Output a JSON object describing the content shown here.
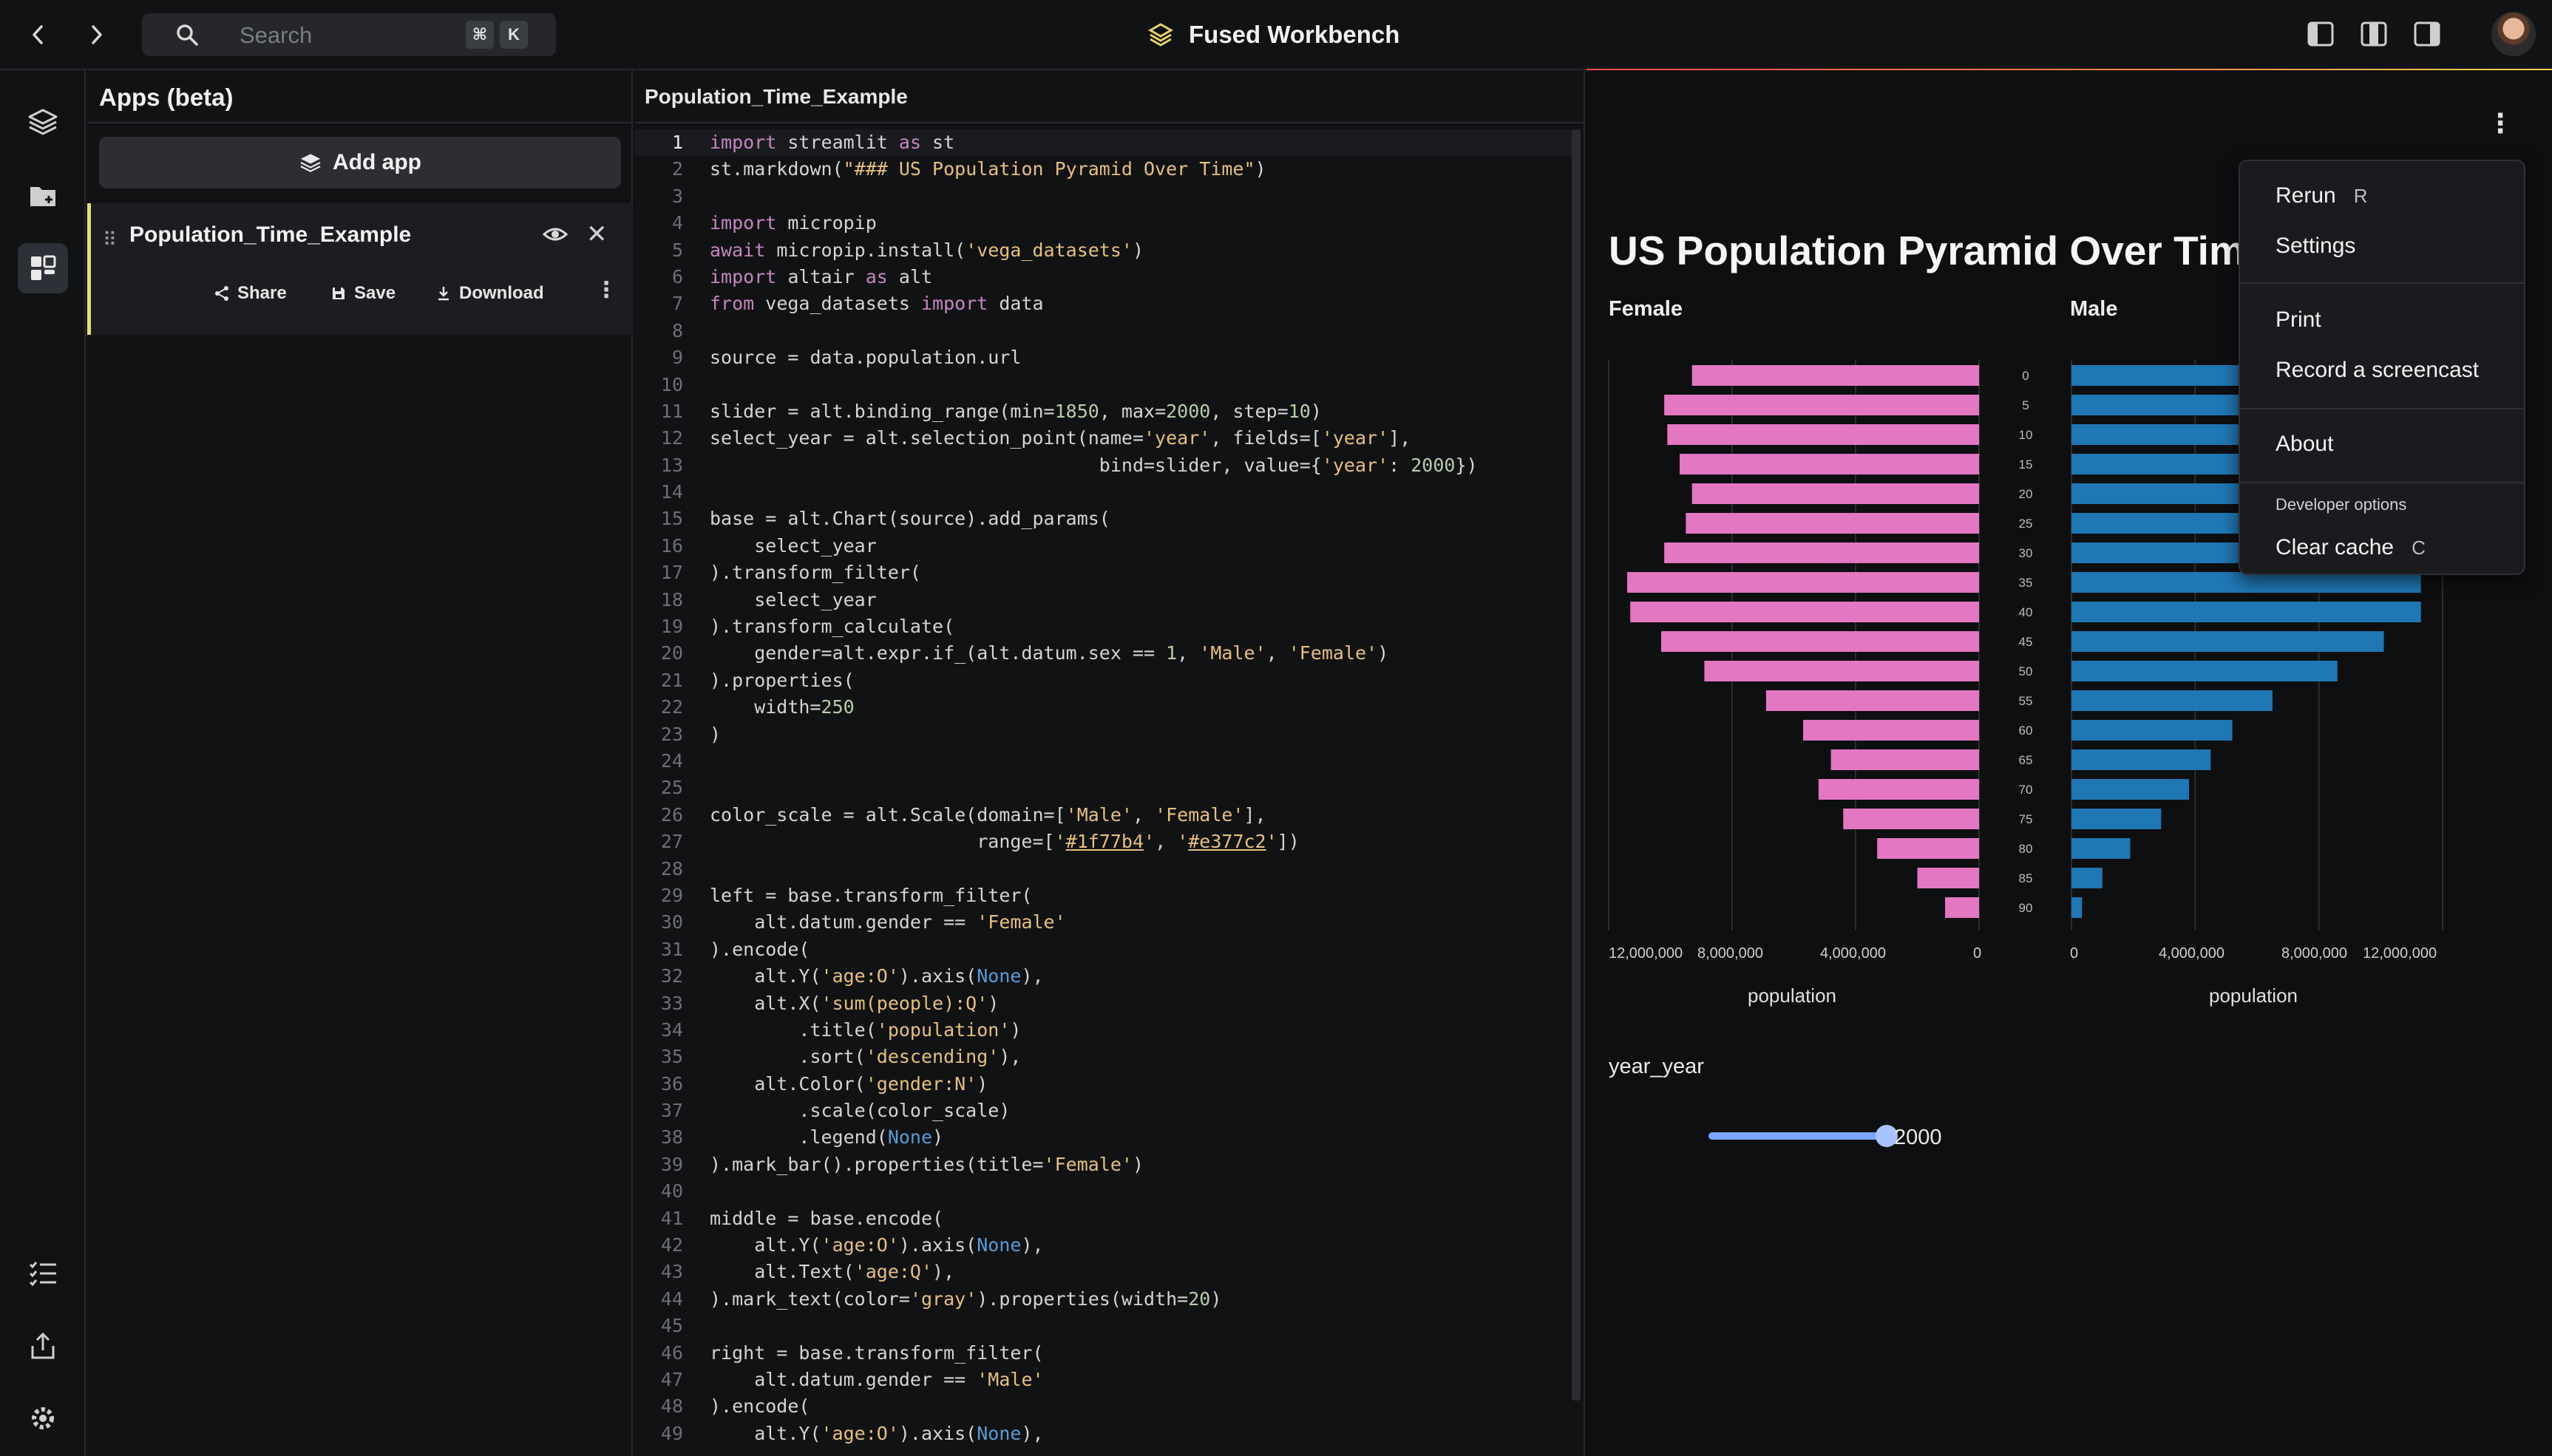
{
  "topbar": {
    "search_placeholder": "Search",
    "shortcut_keys": [
      "⌘",
      "K"
    ],
    "app_title": "Fused Workbench"
  },
  "apps_panel": {
    "title": "Apps (beta)",
    "add_app_label": "Add app",
    "app_item": {
      "name": "Population_Time_Example",
      "actions": {
        "share": "Share",
        "save": "Save",
        "download": "Download"
      }
    }
  },
  "editor": {
    "tab": "Population_Time_Example",
    "current_line": 1,
    "lines": [
      "import streamlit as st",
      "st.markdown(\"### US Population Pyramid Over Time\")",
      "",
      "import micropip",
      "await micropip.install('vega_datasets')",
      "import altair as alt",
      "from vega_datasets import data",
      "",
      "source = data.population.url",
      "",
      "slider = alt.binding_range(min=1850, max=2000, step=10)",
      "select_year = alt.selection_point(name='year', fields=['year'],",
      "                                   bind=slider, value={'year': 2000})",
      "",
      "base = alt.Chart(source).add_params(",
      "    select_year",
      ").transform_filter(",
      "    select_year",
      ").transform_calculate(",
      "    gender=alt.expr.if_(alt.datum.sex == 1, 'Male', 'Female')",
      ").properties(",
      "    width=250",
      ")",
      "",
      "",
      "color_scale = alt.Scale(domain=['Male', 'Female'],",
      "                        range=['#1f77b4', '#e377c2'])",
      "",
      "left = base.transform_filter(",
      "    alt.datum.gender == 'Female'",
      ").encode(",
      "    alt.Y('age:O').axis(None),",
      "    alt.X('sum(people):Q')",
      "        .title('population')",
      "        .sort('descending'),",
      "    alt.Color('gender:N')",
      "        .scale(color_scale)",
      "        .legend(None)",
      ").mark_bar().properties(title='Female')",
      "",
      "middle = base.encode(",
      "    alt.Y('age:O').axis(None),",
      "    alt.Text('age:Q'),",
      ").mark_text(color='gray').properties(width=20)",
      "",
      "right = base.transform_filter(",
      "    alt.datum.gender == 'Male'",
      ").encode(",
      "    alt.Y('age:O').axis(None),"
    ]
  },
  "preview": {
    "menu": {
      "items": [
        {
          "label": "Rerun",
          "key": "R"
        },
        {
          "label": "Settings",
          "key": ""
        },
        {
          "label": "Print",
          "key": ""
        },
        {
          "label": "Record a screencast",
          "key": ""
        },
        {
          "label": "About",
          "key": ""
        }
      ],
      "developer_header": "Developer options",
      "clear_cache": {
        "label": "Clear cache",
        "key": "C"
      }
    },
    "slider": {
      "label": "year_year",
      "value": "2000",
      "min": 1850,
      "max": 2000,
      "fraction": 1.0
    }
  },
  "colors": {
    "female": "#e377c2",
    "male": "#1f77b4",
    "accent": "#7da6ff"
  },
  "chart_data": {
    "type": "bar",
    "title": "US Population Pyramid Over Time",
    "categories": [
      "0",
      "5",
      "10",
      "15",
      "20",
      "25",
      "30",
      "35",
      "40",
      "45",
      "50",
      "55",
      "60",
      "65",
      "70",
      "75",
      "80",
      "85",
      "90"
    ],
    "series": [
      {
        "name": "Female",
        "values": [
          9300000,
          10200000,
          10100000,
          9700000,
          9300000,
          9500000,
          10200000,
          11400000,
          11300000,
          10300000,
          8900000,
          6900000,
          5700000,
          4800000,
          5200000,
          4400000,
          3300000,
          2000000,
          1100000
        ]
      },
      {
        "name": "Male",
        "values": [
          9800000,
          10600000,
          10500000,
          10100000,
          9700000,
          9700000,
          10400000,
          11300000,
          11300000,
          10100000,
          8600000,
          6500000,
          5200000,
          4500000,
          3800000,
          2900000,
          1900000,
          1000000,
          340000
        ]
      }
    ],
    "panels": [
      {
        "title": "Female",
        "xlabel": "population",
        "xticks": [
          "12,000,000",
          "8,000,000",
          "4,000,000",
          "0"
        ],
        "sort": "descending"
      },
      {
        "title": "Male",
        "xlabel": "population",
        "xticks": [
          "0",
          "4,000,000",
          "8,000,000",
          "12,000,000"
        ],
        "sort": "ascending"
      }
    ],
    "xlim": [
      0,
      12000000
    ],
    "grid": true
  }
}
